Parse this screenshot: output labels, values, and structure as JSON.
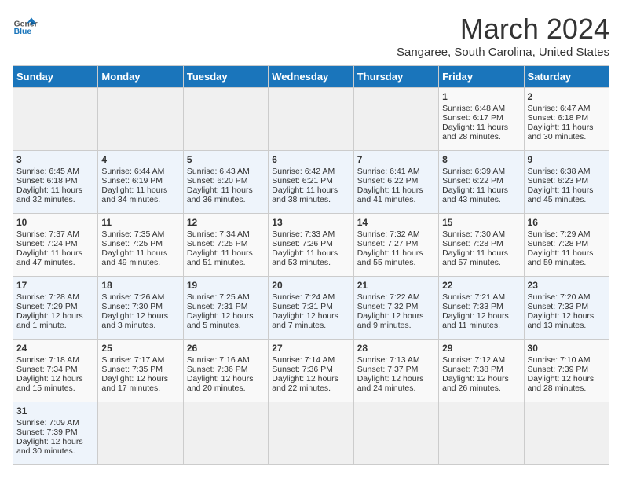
{
  "header": {
    "logo_general": "General",
    "logo_blue": "Blue",
    "month": "March 2024",
    "location": "Sangaree, South Carolina, United States"
  },
  "weekdays": [
    "Sunday",
    "Monday",
    "Tuesday",
    "Wednesday",
    "Thursday",
    "Friday",
    "Saturday"
  ],
  "weeks": [
    [
      {
        "day": "",
        "empty": true
      },
      {
        "day": "",
        "empty": true
      },
      {
        "day": "",
        "empty": true
      },
      {
        "day": "",
        "empty": true
      },
      {
        "day": "",
        "empty": true
      },
      {
        "day": "1",
        "sunrise": "6:48 AM",
        "sunset": "6:17 PM",
        "daylight_hours": "11",
        "daylight_minutes": "28"
      },
      {
        "day": "2",
        "sunrise": "6:47 AM",
        "sunset": "6:18 PM",
        "daylight_hours": "11",
        "daylight_minutes": "30"
      }
    ],
    [
      {
        "day": "3",
        "sunrise": "6:45 AM",
        "sunset": "6:18 PM",
        "daylight_hours": "11",
        "daylight_minutes": "32"
      },
      {
        "day": "4",
        "sunrise": "6:44 AM",
        "sunset": "6:19 PM",
        "daylight_hours": "11",
        "daylight_minutes": "34"
      },
      {
        "day": "5",
        "sunrise": "6:43 AM",
        "sunset": "6:20 PM",
        "daylight_hours": "11",
        "daylight_minutes": "36"
      },
      {
        "day": "6",
        "sunrise": "6:42 AM",
        "sunset": "6:21 PM",
        "daylight_hours": "11",
        "daylight_minutes": "38"
      },
      {
        "day": "7",
        "sunrise": "6:41 AM",
        "sunset": "6:22 PM",
        "daylight_hours": "11",
        "daylight_minutes": "41"
      },
      {
        "day": "8",
        "sunrise": "6:39 AM",
        "sunset": "6:22 PM",
        "daylight_hours": "11",
        "daylight_minutes": "43"
      },
      {
        "day": "9",
        "sunrise": "6:38 AM",
        "sunset": "6:23 PM",
        "daylight_hours": "11",
        "daylight_minutes": "45"
      }
    ],
    [
      {
        "day": "10",
        "sunrise": "7:37 AM",
        "sunset": "7:24 PM",
        "daylight_hours": "11",
        "daylight_minutes": "47"
      },
      {
        "day": "11",
        "sunrise": "7:35 AM",
        "sunset": "7:25 PM",
        "daylight_hours": "11",
        "daylight_minutes": "49"
      },
      {
        "day": "12",
        "sunrise": "7:34 AM",
        "sunset": "7:25 PM",
        "daylight_hours": "11",
        "daylight_minutes": "51"
      },
      {
        "day": "13",
        "sunrise": "7:33 AM",
        "sunset": "7:26 PM",
        "daylight_hours": "11",
        "daylight_minutes": "53"
      },
      {
        "day": "14",
        "sunrise": "7:32 AM",
        "sunset": "7:27 PM",
        "daylight_hours": "11",
        "daylight_minutes": "55"
      },
      {
        "day": "15",
        "sunrise": "7:30 AM",
        "sunset": "7:28 PM",
        "daylight_hours": "11",
        "daylight_minutes": "57"
      },
      {
        "day": "16",
        "sunrise": "7:29 AM",
        "sunset": "7:28 PM",
        "daylight_hours": "11",
        "daylight_minutes": "59"
      }
    ],
    [
      {
        "day": "17",
        "sunrise": "7:28 AM",
        "sunset": "7:29 PM",
        "daylight_hours": "12",
        "daylight_minutes": "1"
      },
      {
        "day": "18",
        "sunrise": "7:26 AM",
        "sunset": "7:30 PM",
        "daylight_hours": "12",
        "daylight_minutes": "3"
      },
      {
        "day": "19",
        "sunrise": "7:25 AM",
        "sunset": "7:31 PM",
        "daylight_hours": "12",
        "daylight_minutes": "5"
      },
      {
        "day": "20",
        "sunrise": "7:24 AM",
        "sunset": "7:31 PM",
        "daylight_hours": "12",
        "daylight_minutes": "7"
      },
      {
        "day": "21",
        "sunrise": "7:22 AM",
        "sunset": "7:32 PM",
        "daylight_hours": "12",
        "daylight_minutes": "9"
      },
      {
        "day": "22",
        "sunrise": "7:21 AM",
        "sunset": "7:33 PM",
        "daylight_hours": "12",
        "daylight_minutes": "11"
      },
      {
        "day": "23",
        "sunrise": "7:20 AM",
        "sunset": "7:33 PM",
        "daylight_hours": "12",
        "daylight_minutes": "13"
      }
    ],
    [
      {
        "day": "24",
        "sunrise": "7:18 AM",
        "sunset": "7:34 PM",
        "daylight_hours": "12",
        "daylight_minutes": "15"
      },
      {
        "day": "25",
        "sunrise": "7:17 AM",
        "sunset": "7:35 PM",
        "daylight_hours": "12",
        "daylight_minutes": "17"
      },
      {
        "day": "26",
        "sunrise": "7:16 AM",
        "sunset": "7:36 PM",
        "daylight_hours": "12",
        "daylight_minutes": "20"
      },
      {
        "day": "27",
        "sunrise": "7:14 AM",
        "sunset": "7:36 PM",
        "daylight_hours": "12",
        "daylight_minutes": "22"
      },
      {
        "day": "28",
        "sunrise": "7:13 AM",
        "sunset": "7:37 PM",
        "daylight_hours": "12",
        "daylight_minutes": "24"
      },
      {
        "day": "29",
        "sunrise": "7:12 AM",
        "sunset": "7:38 PM",
        "daylight_hours": "12",
        "daylight_minutes": "26"
      },
      {
        "day": "30",
        "sunrise": "7:10 AM",
        "sunset": "7:39 PM",
        "daylight_hours": "12",
        "daylight_minutes": "28"
      }
    ],
    [
      {
        "day": "31",
        "sunrise": "7:09 AM",
        "sunset": "7:39 PM",
        "daylight_hours": "12",
        "daylight_minutes": "30"
      },
      {
        "day": "",
        "empty": true
      },
      {
        "day": "",
        "empty": true
      },
      {
        "day": "",
        "empty": true
      },
      {
        "day": "",
        "empty": true
      },
      {
        "day": "",
        "empty": true
      },
      {
        "day": "",
        "empty": true
      }
    ]
  ]
}
